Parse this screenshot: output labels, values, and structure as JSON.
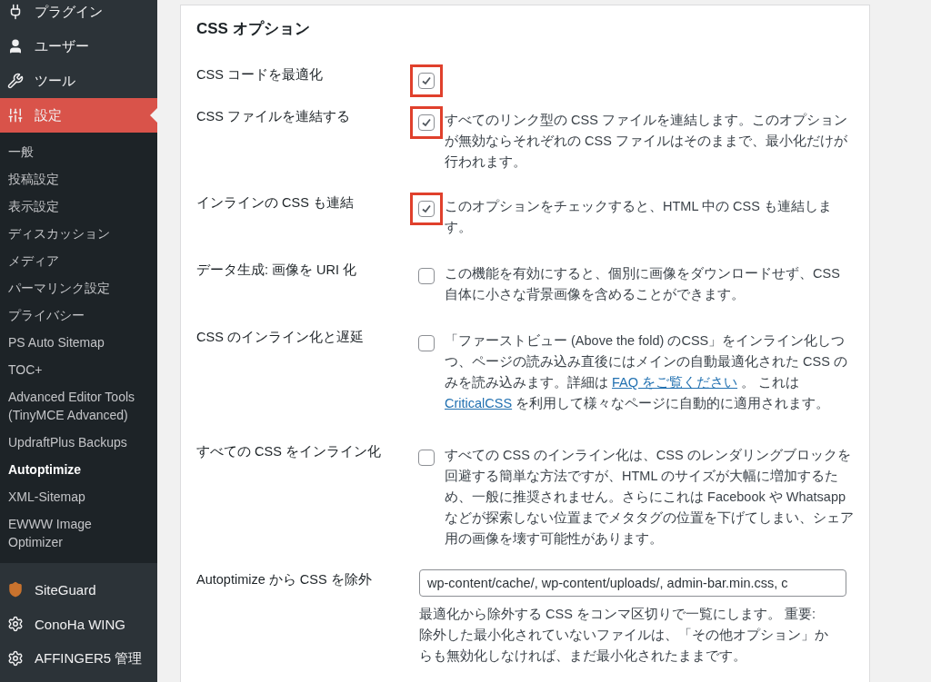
{
  "sidebar": {
    "menu": [
      {
        "label": "プラグイン",
        "selected": false
      },
      {
        "label": "ユーザー",
        "selected": false
      },
      {
        "label": "ツール",
        "selected": false
      },
      {
        "label": "設定",
        "selected": true
      }
    ],
    "submenu": [
      {
        "label": "一般",
        "selected": false
      },
      {
        "label": "投稿設定",
        "selected": false
      },
      {
        "label": "表示設定",
        "selected": false
      },
      {
        "label": "ディスカッション",
        "selected": false
      },
      {
        "label": "メディア",
        "selected": false
      },
      {
        "label": "パーマリンク設定",
        "selected": false
      },
      {
        "label": "プライバシー",
        "selected": false
      },
      {
        "label": "PS Auto Sitemap",
        "selected": false
      },
      {
        "label": "TOC+",
        "selected": false
      },
      {
        "label": "Advanced Editor Tools (TinyMCE Advanced)",
        "selected": false
      },
      {
        "label": "UpdraftPlus Backups",
        "selected": false
      },
      {
        "label": "Autoptimize",
        "selected": true
      },
      {
        "label": "XML-Sitemap",
        "selected": false
      },
      {
        "label": "EWWW Image Optimizer",
        "selected": false
      }
    ],
    "plugins_menu": [
      {
        "label": "SiteGuard"
      },
      {
        "label": "ConoHa WING"
      },
      {
        "label": "AFFINGER5 管理"
      }
    ]
  },
  "panel": {
    "title": "CSS オプション",
    "options": [
      {
        "kind": "checkbox",
        "label": "CSS コードを最適化",
        "checked": true,
        "highlighted": true
      },
      {
        "kind": "checkbox",
        "label": "CSS ファイルを連結する",
        "checked": true,
        "highlighted": true,
        "description": [
          {
            "kind": "text",
            "text": "すべてのリンク型の CSS ファイルを連結します。このオプションが無効ならそれぞれの CSS ファイルはそのままで、最小化だけが行われます。"
          }
        ]
      },
      {
        "kind": "checkbox",
        "label": "インラインの CSS も連結",
        "checked": true,
        "highlighted": true,
        "description": [
          {
            "kind": "text",
            "text": "このオプションをチェックすると、HTML 中の CSS も連結します。"
          }
        ]
      },
      {
        "kind": "checkbox",
        "label": "データ生成: 画像を URI 化",
        "checked": false,
        "highlighted": false,
        "description": [
          {
            "kind": "text",
            "text": "この機能を有効にすると、個別に画像をダウンロードせず、CSS 自体に小さな背景画像を含めることができます。"
          }
        ]
      },
      {
        "kind": "checkbox",
        "label": "CSS のインライン化と遅延",
        "checked": false,
        "highlighted": false,
        "description": [
          {
            "kind": "text",
            "text": "「ファーストビュー (Above the fold) のCSS」をインライン化しつつ、ページの読み込み直後にはメインの自動最適化された CSS のみを読み込みます。詳細は "
          },
          {
            "kind": "link",
            "text": "FAQ をご覧ください"
          },
          {
            "kind": "text",
            "text": " 。 これは "
          },
          {
            "kind": "link",
            "text": "CriticalCSS"
          },
          {
            "kind": "text",
            "text": " を利用して様々なページに自動的に適用されます。"
          }
        ]
      },
      {
        "kind": "checkbox",
        "label": "すべての CSS をインライン化",
        "checked": false,
        "highlighted": false,
        "description": [
          {
            "kind": "text",
            "text": "すべての CSS のインライン化は、CSS のレンダリングブロックを回避する簡単な方法ですが、HTML のサイズが大幅に増加するため、一般に推奨されません。さらにこれは Facebook や Whatsapp などが探索しない位置までメタタグの位置を下げてしまい、シェア用の画像を壊す可能性があります。"
          }
        ]
      },
      {
        "kind": "text",
        "label": "Autoptimize から CSS を除外",
        "value": "wp-content/cache/, wp-content/uploads/, admin-bar.min.css, c",
        "description": [
          {
            "kind": "text",
            "text": "最適化から除外する CSS をコンマ区切りで一覧にします。 重要: 除外した最小化されていないファイルは、「その他オプション」からも無効化しなければ、まだ最小化されたままです。"
          }
        ]
      }
    ]
  }
}
